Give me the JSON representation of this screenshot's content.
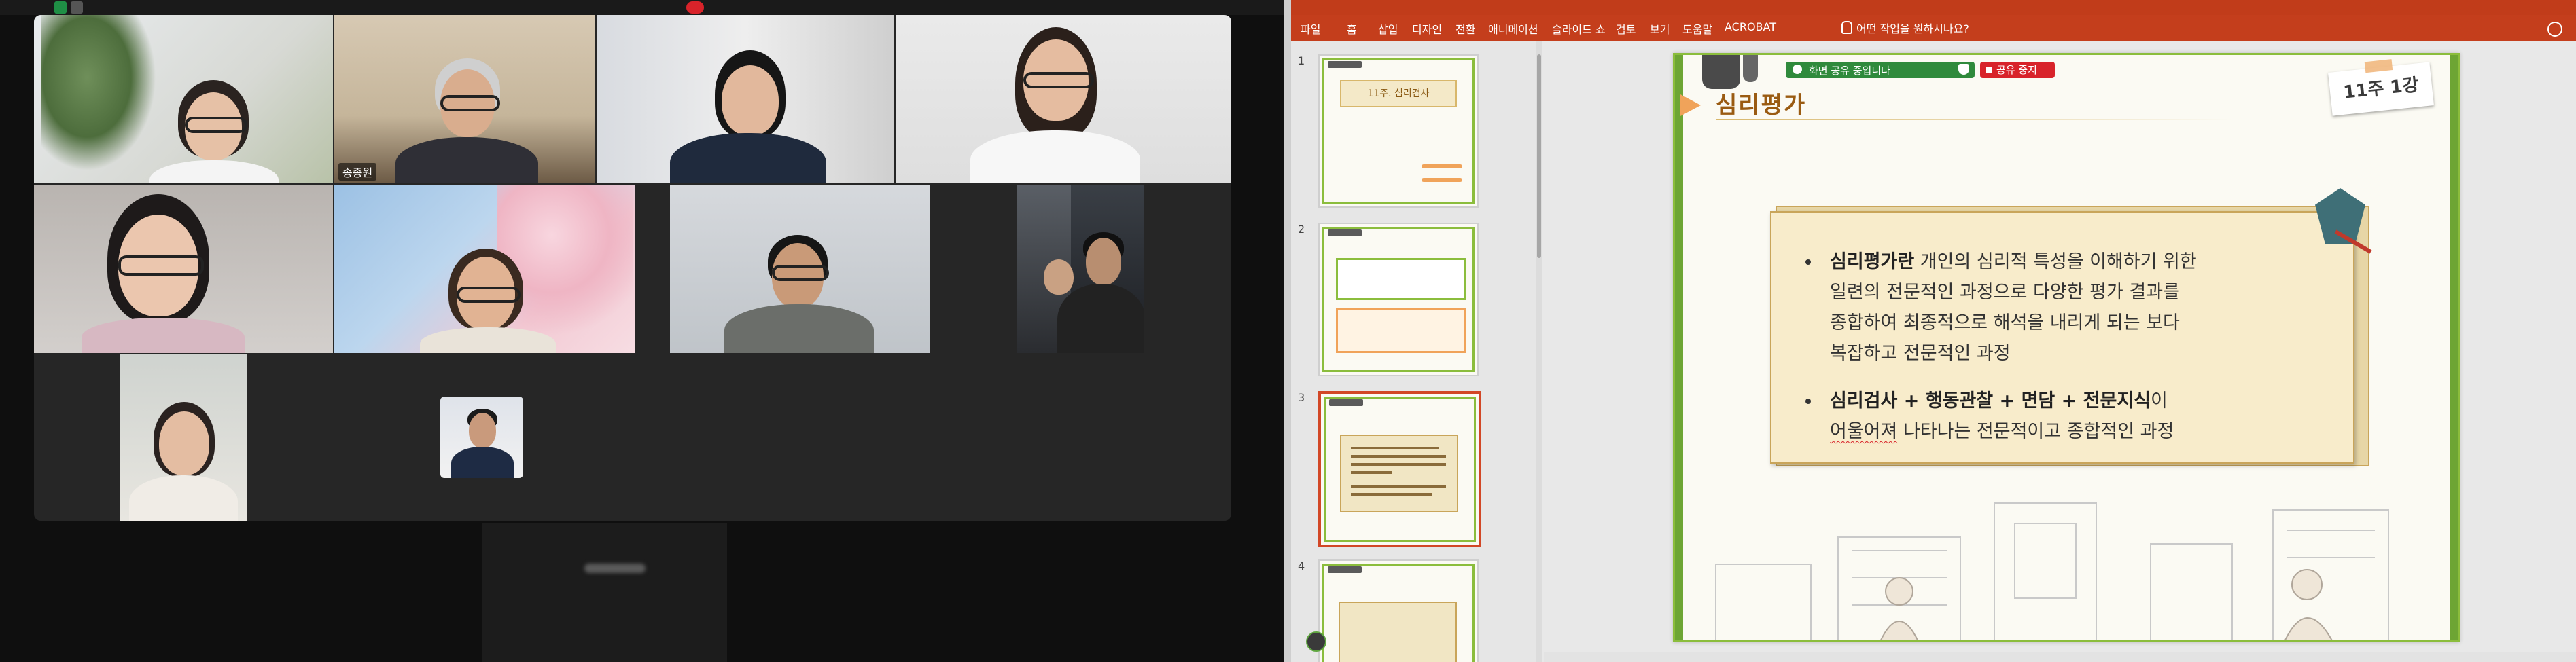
{
  "meeting": {
    "participants": [
      {
        "name": ""
      },
      {
        "name": "송종원"
      },
      {
        "name": ""
      },
      {
        "name": ""
      },
      {
        "name": ""
      },
      {
        "name": ""
      },
      {
        "name": ""
      },
      {
        "name": ""
      },
      {
        "name": ""
      },
      {
        "name": ""
      }
    ]
  },
  "powerpoint": {
    "tabs": [
      "파일",
      "홈",
      "삽입",
      "디자인",
      "전환",
      "애니메이션",
      "슬라이드 쇼",
      "검토",
      "보기",
      "도움말",
      "ACROBAT"
    ],
    "tell_me": "어떤 작업을 원하시나요?",
    "thumbnails": [
      {
        "number": "1",
        "title": "11주. 심리검사"
      },
      {
        "number": "2",
        "title": ""
      },
      {
        "number": "3",
        "title": ""
      },
      {
        "number": "4",
        "title": ""
      }
    ],
    "slide": {
      "title": "심리평가",
      "share_text": "화면 공유 중입니다",
      "stop_share": "공유 중지",
      "week_badge": "11주 1강",
      "bullet1_bold": "심리평가란",
      "bullet1_line1": " 개인의 심리적 특성을 이해하기 위한",
      "bullet1_line2": "일련의 전문적인 과정으로 다양한 평가 결과를",
      "bullet1_line3": "종합하여 최종적으로 해석을 내리게 되는 보다",
      "bullet1_line4": "복잡하고 전문적인 과정",
      "bullet2_bold": "심리검사 + 행동관찰 + 면담 + 전문지식",
      "bullet2_rest": "이",
      "bullet2_underlined": "어울어져",
      "bullet2_line2_rest": " 나타나는 전문적이고 종합적인 과정"
    }
  },
  "colors": {
    "accent_green": "#8bbd3c",
    "ppt_ribbon": "#c43e1c",
    "title_brown": "#9a5b12",
    "stop_red": "#d8232a"
  }
}
